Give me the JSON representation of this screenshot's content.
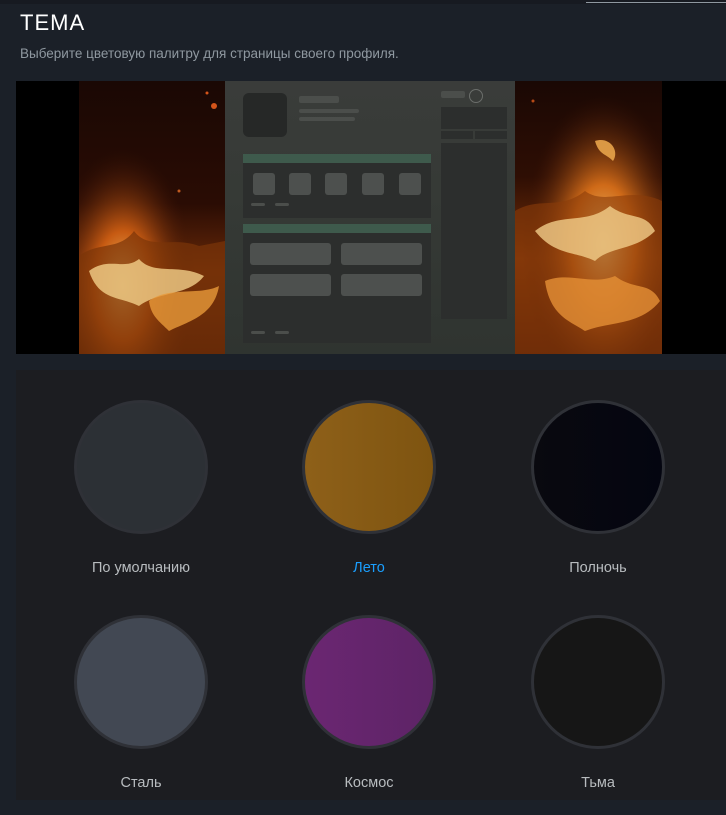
{
  "section": {
    "title": "ТЕМА",
    "subtitle": "Выберите цветовую палитру для страницы своего профиля."
  },
  "themes": [
    {
      "label": "По умолчанию",
      "color": "#2c3035",
      "selected": false
    },
    {
      "label": "Лето",
      "color": "#8a5c14",
      "selected": true
    },
    {
      "label": "Полночь",
      "color": "#07070f",
      "selected": false
    },
    {
      "label": "Сталь",
      "color": "#424853",
      "selected": false
    },
    {
      "label": "Космос",
      "color": "#65256e",
      "selected": false
    },
    {
      "label": "Тьма",
      "color": "#161616",
      "selected": false
    }
  ]
}
